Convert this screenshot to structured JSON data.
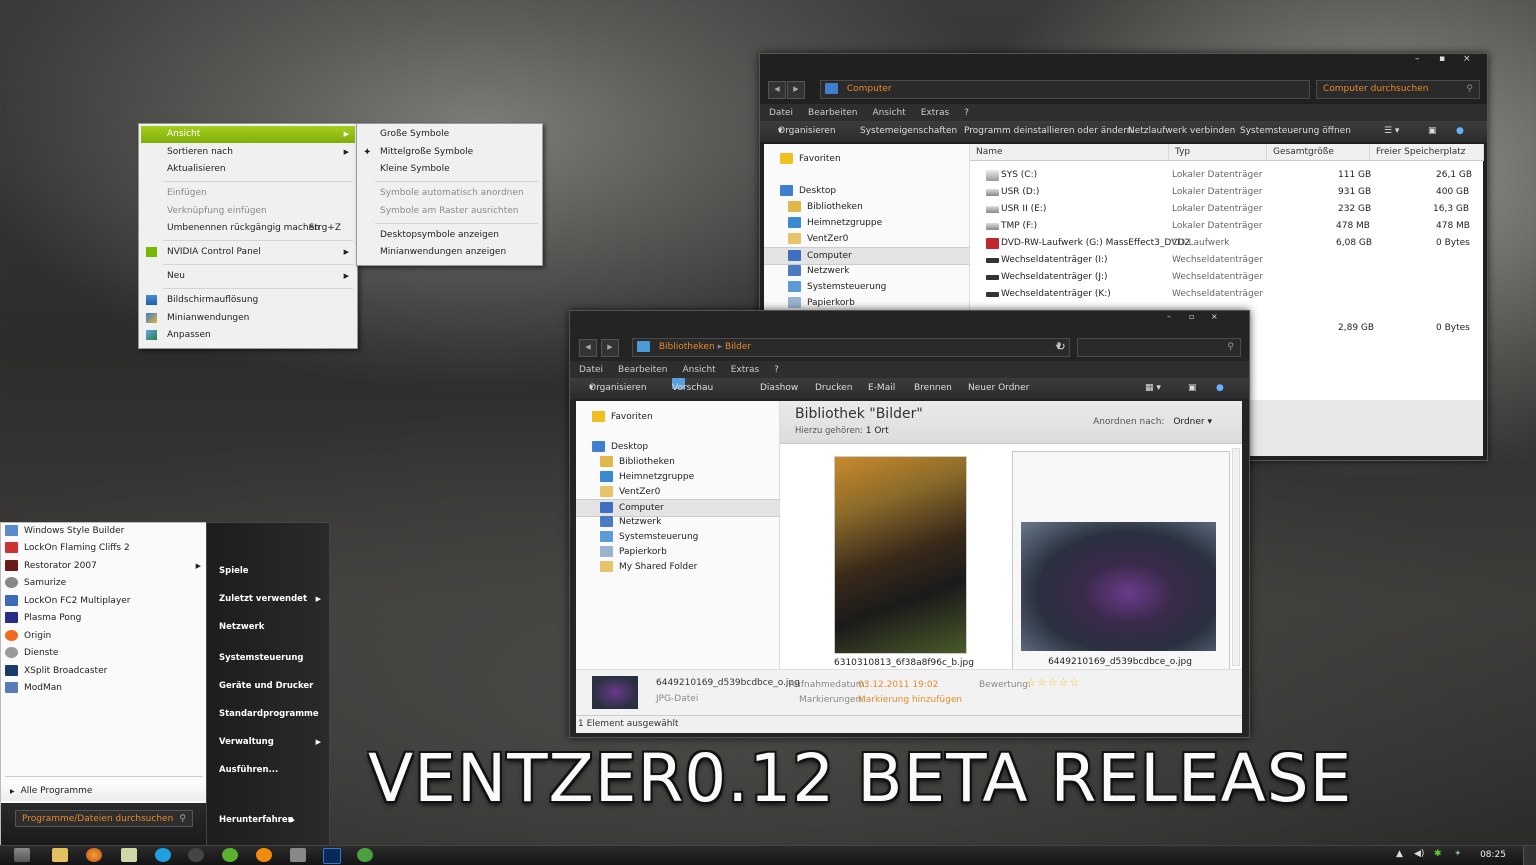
{
  "context_menu": {
    "items": [
      {
        "label": "Ansicht",
        "highlight": true,
        "submenu": true
      },
      {
        "label": "Sortieren nach",
        "submenu": true
      },
      {
        "label": "Aktualisieren"
      },
      {
        "label": "Einfügen",
        "disabled": true
      },
      {
        "label": "Verknüpfung einfügen",
        "disabled": true
      },
      {
        "label": "Umbenennen rückgängig machen",
        "shortcut": "Strg+Z"
      },
      {
        "label": "NVIDIA Control Panel",
        "submenu": true
      },
      {
        "label": "Neu",
        "submenu": true
      },
      {
        "label": "Bildschirmauflösung"
      },
      {
        "label": "Minianwendungen"
      },
      {
        "label": "Anpassen"
      }
    ],
    "submenu": [
      {
        "label": "Große Symbole"
      },
      {
        "label": "Mittelgroße Symbole",
        "checked": true
      },
      {
        "label": "Kleine Symbole"
      },
      {
        "label": "Symbole automatisch anordnen",
        "disabled": true
      },
      {
        "label": "Symbole am Raster ausrichten",
        "disabled": true
      },
      {
        "label": "Desktopsymbole anzeigen"
      },
      {
        "label": "Minianwendungen anzeigen"
      }
    ]
  },
  "computer_window": {
    "address": "Computer",
    "search_placeholder": "Computer durchsuchen",
    "menu": [
      "Datei",
      "Bearbeiten",
      "Ansicht",
      "Extras",
      "?"
    ],
    "commands": [
      "Organisieren",
      "Systemeigenschaften",
      "Programm deinstallieren oder ändern",
      "Netzlaufwerk verbinden",
      "Systemsteuerung öffnen"
    ],
    "nav": [
      "Favoriten",
      "Desktop",
      "Bibliotheken",
      "Heimnetzgruppe",
      "VentZer0",
      "Computer",
      "Netzwerk",
      "Systemsteuerung",
      "Papierkorb"
    ],
    "columns": [
      "Name",
      "Typ",
      "Gesamtgröße",
      "Freier Speicherplatz"
    ],
    "drives": [
      {
        "name": "SYS (C:)",
        "type": "Lokaler Datenträger",
        "total": "111 GB",
        "free": "26,1 GB"
      },
      {
        "name": "USR (D:)",
        "type": "Lokaler Datenträger",
        "total": "931 GB",
        "free": "400 GB"
      },
      {
        "name": "USR II (E:)",
        "type": "Lokaler Datenträger",
        "total": "232 GB",
        "free": "16,3 GB"
      },
      {
        "name": "TMP (F:)",
        "type": "Lokaler Datenträger",
        "total": "478 MB",
        "free": "478 MB"
      },
      {
        "name": "DVD-RW-Laufwerk (G:) MassEffect3_DVD2",
        "type": "CD-Laufwerk",
        "total": "6,08 GB",
        "free": "0 Bytes"
      },
      {
        "name": "Wechseldatenträger (I:)",
        "type": "Wechseldatenträger",
        "total": "",
        "free": ""
      },
      {
        "name": "Wechseldatenträger (J:)",
        "type": "Wechseldatenträger",
        "total": "",
        "free": ""
      },
      {
        "name": "Wechseldatenträger (K:)",
        "type": "Wechseldatenträger",
        "total": "",
        "free": ""
      }
    ],
    "extra_total": "2,89 GB",
    "extra_free": "0 Bytes"
  },
  "library_window": {
    "breadcrumb": [
      "Bibliotheken",
      "Bilder"
    ],
    "menu": [
      "Datei",
      "Bearbeiten",
      "Ansicht",
      "Extras",
      "?"
    ],
    "commands": [
      "Organisieren",
      "Vorschau",
      "Diashow",
      "Drucken",
      "E-Mail",
      "Brennen",
      "Neuer Ordner"
    ],
    "nav": [
      "Favoriten",
      "Desktop",
      "Bibliotheken",
      "Heimnetzgruppe",
      "VentZer0",
      "Computer",
      "Netzwerk",
      "Systemsteuerung",
      "Papierkorb",
      "My Shared Folder"
    ],
    "heading": "Bibliothek \"Bilder\"",
    "sub_label": "Hierzu gehören:",
    "sub_value": "1 Ort",
    "arrange_label": "Anordnen nach:",
    "arrange_value": "Ordner",
    "files": [
      "6310310813_6f38a8f96c_b.jpg",
      "6449210169_d539bcdbce_o.jpg"
    ],
    "details": {
      "filename": "6449210169_d539bcdbce_o.jpg",
      "filetype": "JPG-Datei",
      "date_label": "Aufnahmedatum:",
      "date_value": "03.12.2011 19:02",
      "tags_label": "Markierungen:",
      "tags_value": "Markierung hinzufügen",
      "rating_label": "Bewertung:",
      "rating": 5
    },
    "status": "1 Element ausgewählt"
  },
  "start_menu": {
    "programs": [
      "Windows Style Builder",
      "LockOn Flaming Cliffs 2",
      "Restorator 2007",
      "Samurize",
      "LockOn FC2 Multiplayer",
      "Plasma Pong",
      "Origin",
      "Dienste",
      "XSplit Broadcaster",
      "ModMan"
    ],
    "all_programs": "Alle Programme",
    "search_placeholder": "Programme/Dateien durchsuchen",
    "right": [
      "Spiele",
      "Zuletzt verwendet",
      "Netzwerk",
      "Systemsteuerung",
      "Geräte und Drucker",
      "Standardprogramme",
      "Verwaltung",
      "Ausführen..."
    ],
    "shutdown": "Herunterfahren"
  },
  "banner": "VENTZER0.12 BETA RELEASE",
  "taskbar": {
    "clock": "08:25"
  },
  "colors": {
    "accent": "#8dba12",
    "orange": "#e88a2a"
  }
}
